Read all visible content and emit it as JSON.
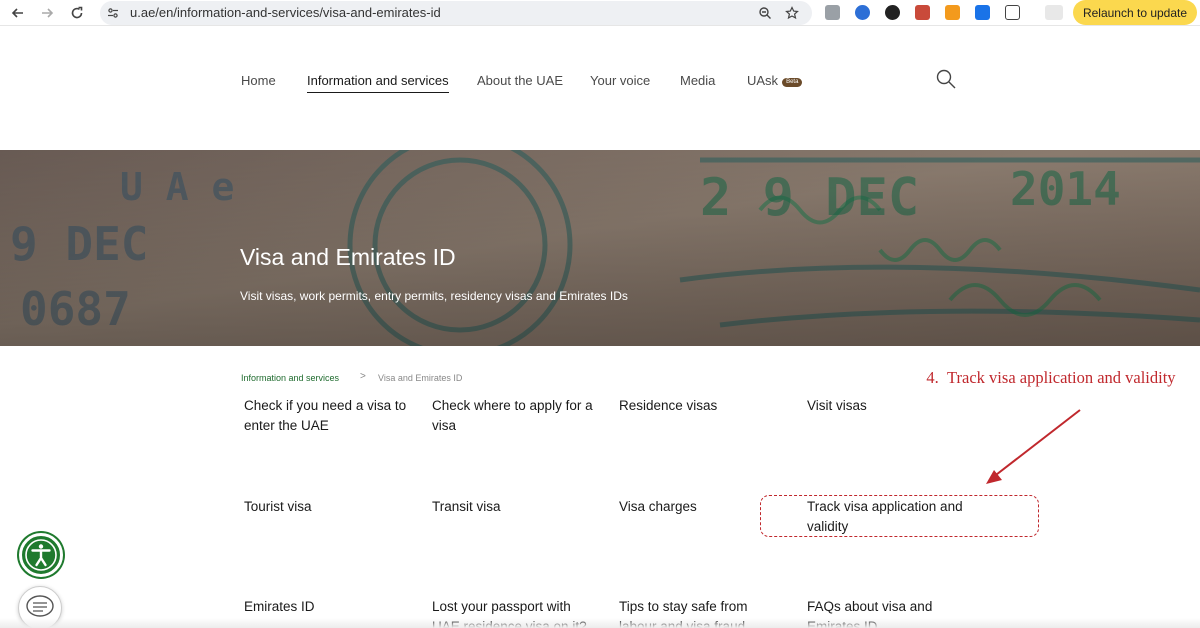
{
  "browser": {
    "url": "u.ae/en/information-and-services/visa-and-emirates-id",
    "relaunch_label": "Relaunch to update"
  },
  "nav": {
    "items": [
      {
        "label": "Home"
      },
      {
        "label": "Information and services",
        "active": true
      },
      {
        "label": "About the UAE"
      },
      {
        "label": "Your voice"
      },
      {
        "label": "Media"
      },
      {
        "label": "UAsk",
        "badge": "Beta"
      }
    ]
  },
  "hero": {
    "title": "Visa and Emirates ID",
    "subtitle": "Visit visas, work permits, entry permits, residency visas and Emirates IDs"
  },
  "breadcrumb": {
    "parent": "Information and services",
    "separator": ">",
    "current": "Visa and Emirates ID"
  },
  "cards": [
    {
      "label": "Check if you need a visa to enter the UAE"
    },
    {
      "label": "Check where to apply for a visa"
    },
    {
      "label": "Residence visas"
    },
    {
      "label": "Visit visas"
    },
    {
      "label": "Tourist visa"
    },
    {
      "label": "Transit visa"
    },
    {
      "label": "Visa charges"
    },
    {
      "label": "Track visa application and validity"
    },
    {
      "label": "Emirates ID"
    },
    {
      "label": "Lost your passport with UAE residence visa on it?"
    },
    {
      "label": "Tips to stay safe from labour and visa fraud"
    },
    {
      "label": "FAQs about visa and Emirates ID"
    }
  ],
  "annotation": {
    "number": "4.",
    "text": "Track visa application and validity"
  },
  "colors": {
    "accent_green": "#1f7a2e",
    "breadcrumb_green": "#1f6b2e",
    "annotation_red": "#c0282d",
    "relaunch_yellow": "#fbd84e"
  },
  "icons": {
    "back": "arrow-left-icon",
    "forward": "arrow-right-icon",
    "reload": "reload-icon",
    "site_info": "tune-icon",
    "zoom": "zoom-icon",
    "bookmark": "star-icon",
    "search": "search-icon",
    "accessibility": "accessibility-icon",
    "chat": "chat-icon"
  }
}
